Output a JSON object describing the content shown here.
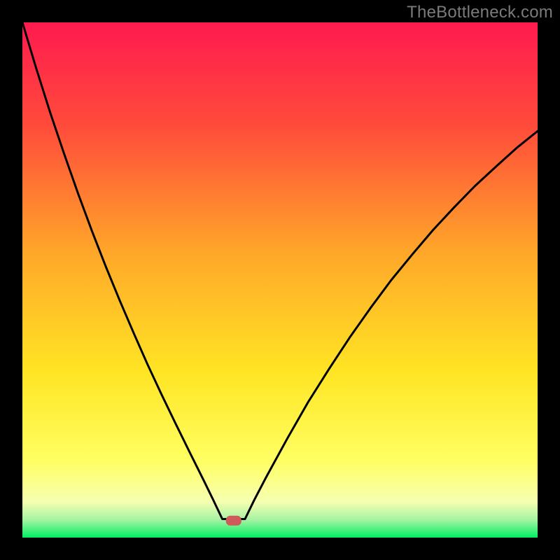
{
  "watermark": "TheBottleneck.com",
  "chart_data": {
    "type": "line",
    "title": "",
    "xlabel": "",
    "ylabel": "",
    "xlim": [
      0,
      100
    ],
    "ylim": [
      0,
      100
    ],
    "grid": false,
    "legend": false,
    "series": [
      {
        "name": "left-curve",
        "x": [
          0,
          2.7,
          5.4,
          8.1,
          10.8,
          13.5,
          16.2,
          18.9,
          21.6,
          24.3,
          27.0,
          29.7,
          32.4,
          35.1,
          37.0,
          38.8
        ],
        "y": [
          100,
          91,
          82.5,
          74.5,
          66.8,
          59.5,
          52.6,
          46.0,
          39.7,
          33.6,
          27.8,
          22.2,
          16.7,
          11.3,
          7.4,
          3.6
        ]
      },
      {
        "name": "right-curve",
        "x": [
          43.2,
          45.0,
          47.3,
          51.4,
          55.4,
          59.5,
          63.5,
          67.6,
          71.6,
          75.7,
          79.7,
          83.8,
          87.8,
          91.9,
          95.9,
          100
        ],
        "y": [
          3.6,
          7.3,
          11.7,
          19.2,
          26.2,
          32.7,
          38.8,
          44.6,
          50.0,
          55.0,
          59.7,
          64.1,
          68.2,
          72.0,
          75.6,
          78.9
        ]
      },
      {
        "name": "bottom-flat",
        "x": [
          38.8,
          43.2
        ],
        "y": [
          3.6,
          3.6
        ]
      }
    ],
    "marker": {
      "name": "optimum-marker",
      "x": 41.0,
      "y": 3.3,
      "color": "#cf5a5a",
      "shape": "rounded-rect"
    },
    "bottom_band": {
      "name": "green-band",
      "y_from": 0,
      "y_to": 5.4,
      "color": "#00ee63"
    },
    "gradient_stops": [
      {
        "offset": 0.0,
        "color": "#ff1a4f"
      },
      {
        "offset": 0.2,
        "color": "#ff4b3b"
      },
      {
        "offset": 0.45,
        "color": "#ffa829"
      },
      {
        "offset": 0.68,
        "color": "#ffe524"
      },
      {
        "offset": 0.85,
        "color": "#ffff62"
      },
      {
        "offset": 0.93,
        "color": "#f6ffb0"
      },
      {
        "offset": 0.965,
        "color": "#a7f3a3"
      },
      {
        "offset": 1.0,
        "color": "#00ee63"
      }
    ],
    "frame": {
      "margin_left": 32,
      "margin_right": 32,
      "margin_top": 32,
      "margin_bottom": 32
    }
  }
}
